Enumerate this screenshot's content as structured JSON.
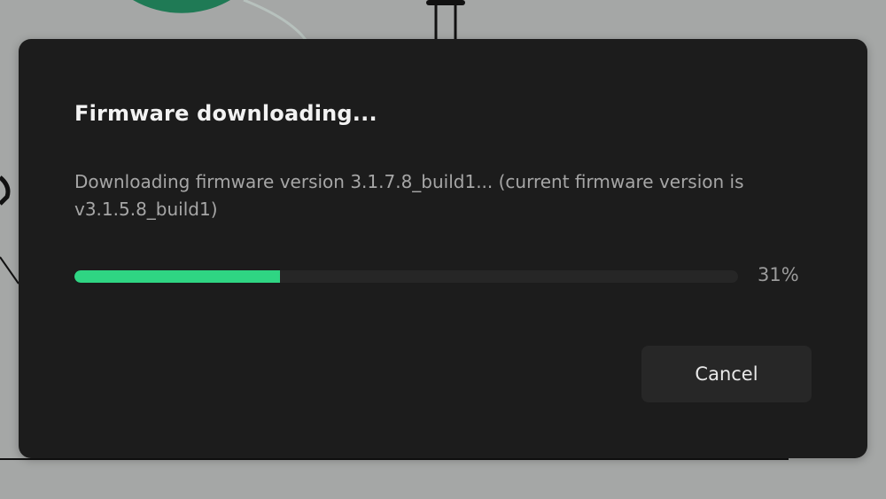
{
  "dialog": {
    "title": "Firmware downloading...",
    "message": "Downloading firmware version 3.1.7.8_build1... (current firmware version is v3.1.5.8_build1)",
    "progress": {
      "fraction": 0.31,
      "label": "31%"
    },
    "cancel_label": "Cancel"
  },
  "colors": {
    "progress_fill": "#2fd583",
    "dialog_background": "#1c1c1c",
    "backdrop": "#a5a7a6"
  }
}
